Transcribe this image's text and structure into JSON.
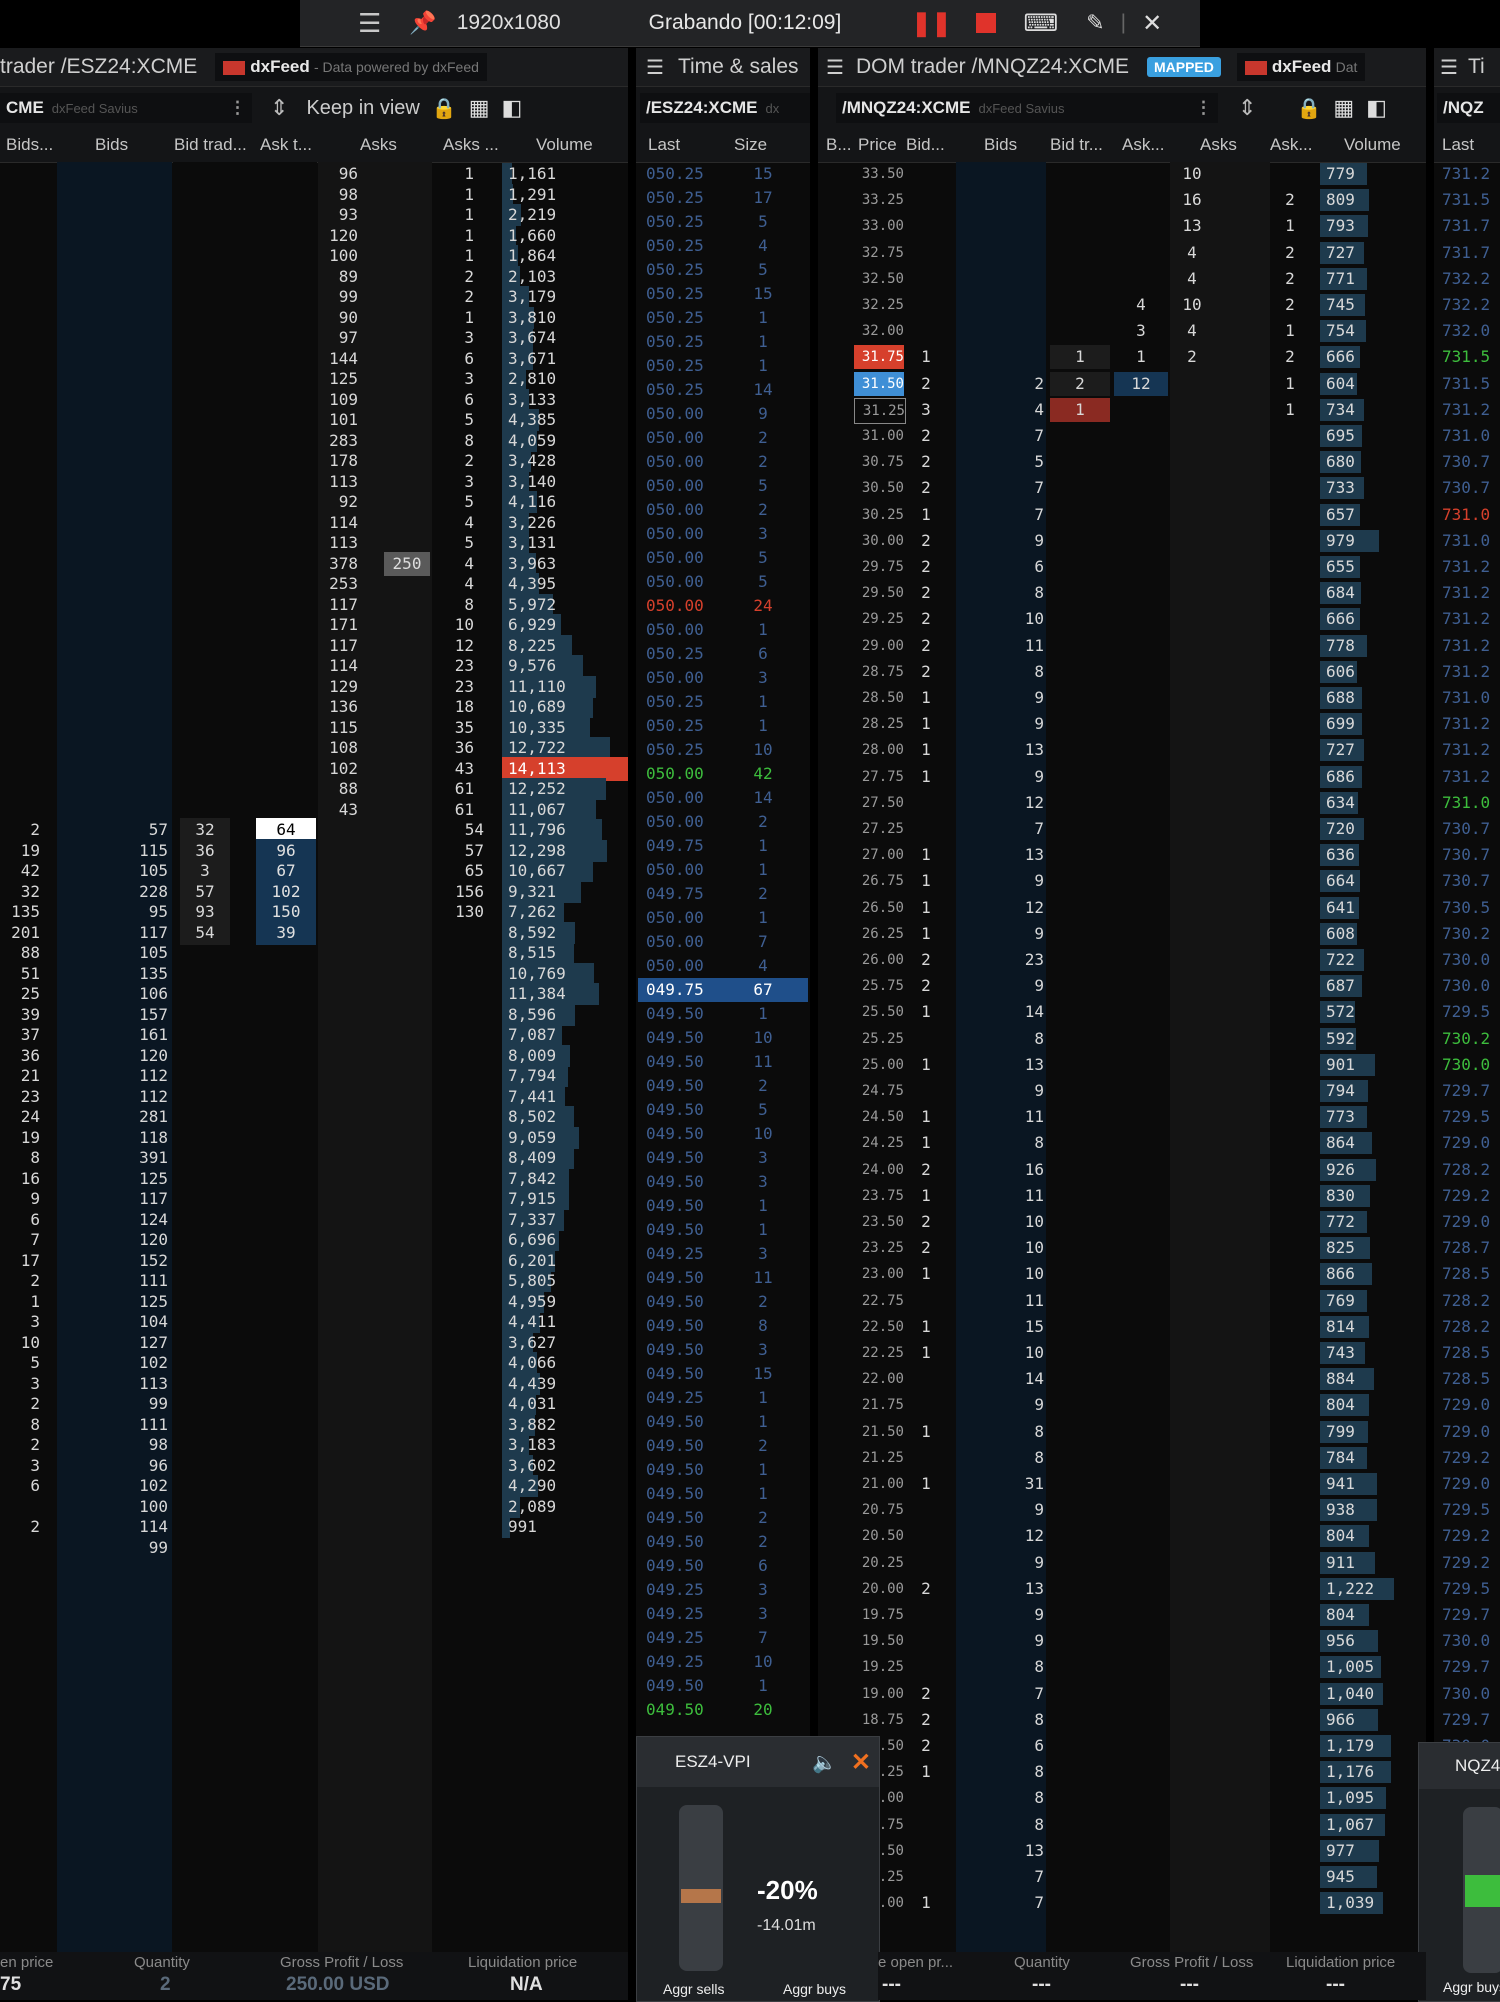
{
  "recorder": {
    "resolution": "1920x1080",
    "status": "Grabando [00:12:09]"
  },
  "es_dom": {
    "title": "trader /ESZ24:XCME",
    "feed_name": "dxFeed",
    "feed_note": "- Data powered by dxFeed",
    "symbol": "CME",
    "symbol_source": "dxFeed Savius",
    "keep_in_view": "Keep in view",
    "columns": [
      "Bids...",
      "Bids",
      "Bid trad...",
      "Ask t...",
      "Asks",
      "Asks ...",
      "Volume"
    ],
    "asks_rows": [
      [
        "96",
        "1",
        "1,161"
      ],
      [
        "98",
        "1",
        "1,291"
      ],
      [
        "93",
        "1",
        "2,219"
      ],
      [
        "120",
        "1",
        "1,660"
      ],
      [
        "100",
        "1",
        "1,864"
      ],
      [
        "89",
        "2",
        "2,103"
      ],
      [
        "99",
        "2",
        "3,179"
      ],
      [
        "90",
        "1",
        "3,810"
      ],
      [
        "97",
        "3",
        "3,674"
      ],
      [
        "144",
        "6",
        "3,671"
      ],
      [
        "125",
        "3",
        "2,810"
      ],
      [
        "109",
        "6",
        "3,133"
      ],
      [
        "101",
        "5",
        "4,385"
      ],
      [
        "283",
        "8",
        "4,059"
      ],
      [
        "178",
        "2",
        "3,428"
      ],
      [
        "113",
        "3",
        "3,140"
      ],
      [
        "92",
        "5",
        "4,116"
      ],
      [
        "114",
        "4",
        "3,226"
      ],
      [
        "113",
        "5",
        "3,131"
      ],
      [
        "378",
        "4",
        "3,963"
      ],
      [
        "253",
        "4",
        "4,395"
      ],
      [
        "117",
        "8",
        "5,972"
      ],
      [
        "171",
        "10",
        "6,929"
      ],
      [
        "117",
        "12",
        "8,225"
      ],
      [
        "114",
        "23",
        "9,576"
      ],
      [
        "129",
        "23",
        "11,110"
      ],
      [
        "136",
        "18",
        "10,689"
      ],
      [
        "115",
        "35",
        "10,335"
      ],
      [
        "108",
        "36",
        "12,722"
      ],
      [
        "102",
        "43",
        "14,113"
      ],
      [
        "88",
        "61",
        "12,252"
      ],
      [
        "43",
        "61",
        "11,067"
      ]
    ],
    "ask_pull_value": "250",
    "mid_rows": [
      [
        "2",
        "57",
        "32",
        "64",
        "54",
        "11,796"
      ],
      [
        "19",
        "115",
        "36",
        "96",
        "57",
        "12,298"
      ],
      [
        "42",
        "105",
        "3",
        "67",
        "65",
        "10,667"
      ],
      [
        "32",
        "228",
        "57",
        "102",
        "156",
        "9,321"
      ],
      [
        "135",
        "95",
        "93",
        "150",
        "130",
        "7,262"
      ],
      [
        "201",
        "117",
        "54",
        "39",
        "",
        "8,592"
      ]
    ],
    "bid_rows": [
      [
        "88",
        "105",
        "8,515"
      ],
      [
        "51",
        "135",
        "10,769"
      ],
      [
        "25",
        "106",
        "11,384"
      ],
      [
        "39",
        "157",
        "8,596"
      ],
      [
        "37",
        "161",
        "7,087"
      ],
      [
        "36",
        "120",
        "8,009"
      ],
      [
        "21",
        "112",
        "7,794"
      ],
      [
        "23",
        "112",
        "7,441"
      ],
      [
        "24",
        "281",
        "8,502"
      ],
      [
        "19",
        "118",
        "9,059"
      ],
      [
        "8",
        "391",
        "8,409"
      ],
      [
        "16",
        "125",
        "7,842"
      ],
      [
        "9",
        "117",
        "7,915"
      ],
      [
        "6",
        "124",
        "7,337"
      ],
      [
        "7",
        "120",
        "6,696"
      ],
      [
        "17",
        "152",
        "6,201"
      ],
      [
        "2",
        "111",
        "5,805"
      ],
      [
        "1",
        "125",
        "4,959"
      ],
      [
        "3",
        "104",
        "4,411"
      ],
      [
        "10",
        "127",
        "3,627"
      ],
      [
        "5",
        "102",
        "4,066"
      ],
      [
        "3",
        "113",
        "4,439"
      ],
      [
        "2",
        "99",
        "4,031"
      ],
      [
        "8",
        "111",
        "3,882"
      ],
      [
        "2",
        "98",
        "3,183"
      ],
      [
        "3",
        "96",
        "3,602"
      ],
      [
        "6",
        "102",
        "4,290"
      ],
      [
        "",
        "100",
        "2,089"
      ],
      [
        "2",
        "114",
        "991"
      ],
      [
        "",
        "99",
        ""
      ]
    ]
  },
  "es_ts": {
    "title": "Time & sales",
    "symbol": "/ESZ24:XCME",
    "symbol_source": "dx",
    "columns": [
      "Last",
      "Size"
    ],
    "rows": [
      [
        "050.25",
        "15"
      ],
      [
        "050.25",
        "17"
      ],
      [
        "050.25",
        "5"
      ],
      [
        "050.25",
        "4"
      ],
      [
        "050.25",
        "5"
      ],
      [
        "050.25",
        "15"
      ],
      [
        "050.25",
        "1"
      ],
      [
        "050.25",
        "1"
      ],
      [
        "050.25",
        "1"
      ],
      [
        "050.25",
        "14"
      ],
      [
        "050.00",
        "9"
      ],
      [
        "050.00",
        "2"
      ],
      [
        "050.00",
        "2"
      ],
      [
        "050.00",
        "5"
      ],
      [
        "050.00",
        "2"
      ],
      [
        "050.00",
        "3"
      ],
      [
        "050.00",
        "5"
      ],
      [
        "050.00",
        "5"
      ],
      [
        "050.00",
        "24"
      ],
      [
        "050.00",
        "1"
      ],
      [
        "050.25",
        "6"
      ],
      [
        "050.00",
        "3"
      ],
      [
        "050.25",
        "1"
      ],
      [
        "050.25",
        "1"
      ],
      [
        "050.25",
        "10"
      ],
      [
        "050.00",
        "42"
      ],
      [
        "050.00",
        "14"
      ],
      [
        "050.00",
        "2"
      ],
      [
        "049.75",
        "1"
      ],
      [
        "050.00",
        "1"
      ],
      [
        "049.75",
        "2"
      ],
      [
        "050.00",
        "1"
      ],
      [
        "050.00",
        "7"
      ],
      [
        "050.00",
        "4"
      ],
      [
        "049.75",
        "67"
      ],
      [
        "049.50",
        "1"
      ],
      [
        "049.50",
        "10"
      ],
      [
        "049.50",
        "11"
      ],
      [
        "049.50",
        "2"
      ],
      [
        "049.50",
        "5"
      ],
      [
        "049.50",
        "10"
      ],
      [
        "049.50",
        "3"
      ],
      [
        "049.50",
        "3"
      ],
      [
        "049.50",
        "1"
      ],
      [
        "049.50",
        "1"
      ],
      [
        "049.25",
        "3"
      ],
      [
        "049.50",
        "11"
      ],
      [
        "049.50",
        "2"
      ],
      [
        "049.50",
        "8"
      ],
      [
        "049.50",
        "3"
      ],
      [
        "049.50",
        "15"
      ],
      [
        "049.25",
        "1"
      ],
      [
        "049.50",
        "1"
      ],
      [
        "049.50",
        "2"
      ],
      [
        "049.50",
        "1"
      ],
      [
        "049.50",
        "1"
      ],
      [
        "049.50",
        "2"
      ],
      [
        "049.50",
        "2"
      ],
      [
        "049.50",
        "6"
      ],
      [
        "049.25",
        "3"
      ],
      [
        "049.25",
        "3"
      ],
      [
        "049.25",
        "7"
      ],
      [
        "049.25",
        "10"
      ],
      [
        "049.50",
        "1"
      ],
      [
        "049.50",
        "20"
      ]
    ]
  },
  "nq_dom": {
    "title": "DOM trader /MNQZ24:XCME",
    "badge": "MAPPED",
    "feed_name": "dxFeed",
    "feed_note": "Dat",
    "symbol": "/MNQZ24:XCME",
    "symbol_source": "dxFeed Savius",
    "columns": [
      "B...",
      "Price",
      "Bid...",
      "Bids",
      "Bid tr...",
      "Ask...",
      "Asks",
      "Ask...",
      "Volume"
    ],
    "rows": [
      [
        "",
        "33.50",
        "",
        "",
        "",
        "",
        "10",
        "",
        "779"
      ],
      [
        "",
        "33.25",
        "",
        "",
        "",
        "",
        "16",
        "2",
        "809"
      ],
      [
        "",
        "33.00",
        "",
        "",
        "",
        "",
        "13",
        "1",
        "793"
      ],
      [
        "",
        "32.75",
        "",
        "",
        "",
        "",
        "4",
        "2",
        "727"
      ],
      [
        "",
        "32.50",
        "",
        "",
        "",
        "",
        "4",
        "2",
        "771"
      ],
      [
        "",
        "32.25",
        "",
        "",
        "",
        "4",
        "10",
        "2",
        "745"
      ],
      [
        "",
        "32.00",
        "",
        "",
        "",
        "3",
        "4",
        "1",
        "754"
      ],
      [
        "",
        "31.75",
        "1",
        "",
        "1",
        "1",
        "2",
        "2",
        "666"
      ],
      [
        "",
        "31.50",
        "2",
        "2",
        "2",
        "12",
        "",
        "1",
        "604"
      ],
      [
        "",
        "31.25",
        "3",
        "4",
        "1",
        "",
        "",
        "1",
        "734"
      ],
      [
        "",
        "31.00",
        "2",
        "7",
        "",
        "",
        "",
        "",
        "695"
      ],
      [
        "",
        "30.75",
        "2",
        "5",
        "",
        "",
        "",
        "",
        "680"
      ],
      [
        "",
        "30.50",
        "2",
        "7",
        "",
        "",
        "",
        "",
        "733"
      ],
      [
        "",
        "30.25",
        "1",
        "7",
        "",
        "",
        "",
        "",
        "657"
      ],
      [
        "",
        "30.00",
        "2",
        "9",
        "",
        "",
        "",
        "",
        "979"
      ],
      [
        "",
        "29.75",
        "2",
        "6",
        "",
        "",
        "",
        "",
        "655"
      ],
      [
        "",
        "29.50",
        "2",
        "8",
        "",
        "",
        "",
        "",
        "684"
      ],
      [
        "",
        "29.25",
        "2",
        "10",
        "",
        "",
        "",
        "",
        "666"
      ],
      [
        "",
        "29.00",
        "2",
        "11",
        "",
        "",
        "",
        "",
        "778"
      ],
      [
        "",
        "28.75",
        "2",
        "8",
        "",
        "",
        "",
        "",
        "606"
      ],
      [
        "",
        "28.50",
        "1",
        "9",
        "",
        "",
        "",
        "",
        "688"
      ],
      [
        "",
        "28.25",
        "1",
        "9",
        "",
        "",
        "",
        "",
        "699"
      ],
      [
        "",
        "28.00",
        "1",
        "13",
        "",
        "",
        "",
        "",
        "727"
      ],
      [
        "",
        "27.75",
        "1",
        "9",
        "",
        "",
        "",
        "",
        "686"
      ],
      [
        "",
        "27.50",
        "",
        "12",
        "",
        "",
        "",
        "",
        "634"
      ],
      [
        "",
        "27.25",
        "",
        "7",
        "",
        "",
        "",
        "",
        "720"
      ],
      [
        "",
        "27.00",
        "1",
        "13",
        "",
        "",
        "",
        "",
        "636"
      ],
      [
        "",
        "26.75",
        "1",
        "9",
        "",
        "",
        "",
        "",
        "664"
      ],
      [
        "",
        "26.50",
        "1",
        "12",
        "",
        "",
        "",
        "",
        "641"
      ],
      [
        "",
        "26.25",
        "1",
        "9",
        "",
        "",
        "",
        "",
        "608"
      ],
      [
        "",
        "26.00",
        "2",
        "23",
        "",
        "",
        "",
        "",
        "722"
      ],
      [
        "",
        "25.75",
        "2",
        "9",
        "",
        "",
        "",
        "",
        "687"
      ],
      [
        "",
        "25.50",
        "1",
        "14",
        "",
        "",
        "",
        "",
        "572"
      ],
      [
        "",
        "25.25",
        "",
        "8",
        "",
        "",
        "",
        "",
        "592"
      ],
      [
        "",
        "25.00",
        "1",
        "13",
        "",
        "",
        "",
        "",
        "901"
      ],
      [
        "",
        "24.75",
        "",
        "9",
        "",
        "",
        "",
        "",
        "794"
      ],
      [
        "",
        "24.50",
        "1",
        "11",
        "",
        "",
        "",
        "",
        "773"
      ],
      [
        "",
        "24.25",
        "1",
        "8",
        "",
        "",
        "",
        "",
        "864"
      ],
      [
        "",
        "24.00",
        "2",
        "16",
        "",
        "",
        "",
        "",
        "926"
      ],
      [
        "",
        "23.75",
        "1",
        "11",
        "",
        "",
        "",
        "",
        "830"
      ],
      [
        "",
        "23.50",
        "2",
        "10",
        "",
        "",
        "",
        "",
        "772"
      ],
      [
        "",
        "23.25",
        "2",
        "10",
        "",
        "",
        "",
        "",
        "825"
      ],
      [
        "",
        "23.00",
        "1",
        "10",
        "",
        "",
        "",
        "",
        "866"
      ],
      [
        "",
        "22.75",
        "",
        "11",
        "",
        "",
        "",
        "",
        "769"
      ],
      [
        "",
        "22.50",
        "1",
        "15",
        "",
        "",
        "",
        "",
        "814"
      ],
      [
        "",
        "22.25",
        "1",
        "10",
        "",
        "",
        "",
        "",
        "743"
      ],
      [
        "",
        "22.00",
        "",
        "14",
        "",
        "",
        "",
        "",
        "884"
      ],
      [
        "",
        "21.75",
        "",
        "9",
        "",
        "",
        "",
        "",
        "804"
      ],
      [
        "",
        "21.50",
        "1",
        "8",
        "",
        "",
        "",
        "",
        "799"
      ],
      [
        "",
        "21.25",
        "",
        "8",
        "",
        "",
        "",
        "",
        "784"
      ],
      [
        "",
        "21.00",
        "1",
        "31",
        "",
        "",
        "",
        "",
        "941"
      ],
      [
        "",
        "20.75",
        "",
        "9",
        "",
        "",
        "",
        "",
        "938"
      ],
      [
        "",
        "20.50",
        "",
        "12",
        "",
        "",
        "",
        "",
        "804"
      ],
      [
        "",
        "20.25",
        "",
        "9",
        "",
        "",
        "",
        "",
        "911"
      ],
      [
        "",
        "20.00",
        "2",
        "13",
        "",
        "",
        "",
        "",
        "1,222"
      ],
      [
        "",
        "19.75",
        "",
        "9",
        "",
        "",
        "",
        "",
        "804"
      ],
      [
        "",
        "19.50",
        "",
        "9",
        "",
        "",
        "",
        "",
        "956"
      ],
      [
        "",
        "19.25",
        "",
        "8",
        "",
        "",
        "",
        "",
        "1,005"
      ],
      [
        "",
        "19.00",
        "2",
        "7",
        "",
        "",
        "",
        "",
        "1,040"
      ],
      [
        "",
        "18.75",
        "2",
        "8",
        "",
        "",
        "",
        "",
        "966"
      ],
      [
        "",
        "18.50",
        "2",
        "6",
        "",
        "",
        "",
        "",
        "1,179"
      ],
      [
        "",
        "18.25",
        "1",
        "8",
        "",
        "",
        "",
        "",
        "1,176"
      ],
      [
        "",
        "18.00",
        "",
        "8",
        "",
        "",
        "",
        "",
        "1,095"
      ],
      [
        "",
        "17.75",
        "",
        "8",
        "",
        "",
        "",
        "",
        "1,067"
      ],
      [
        "",
        "17.50",
        "",
        "13",
        "",
        "",
        "",
        "",
        "977"
      ],
      [
        "",
        "17.25",
        "",
        "7",
        "",
        "",
        "",
        "",
        "945"
      ],
      [
        "",
        "17.00",
        "1",
        "7",
        "",
        "",
        "",
        "",
        "1,039"
      ]
    ]
  },
  "nq_ts": {
    "title": "Ti",
    "symbol": "/NQZ",
    "columns": [
      "Last"
    ],
    "rows": [
      "731.2",
      "731.5",
      "731.7",
      "731.7",
      "732.2",
      "732.2",
      "732.0",
      "731.5",
      "731.5",
      "731.2",
      "731.0",
      "730.7",
      "730.7",
      "731.0",
      "731.0",
      "731.2",
      "731.2",
      "731.2",
      "731.2",
      "731.2",
      "731.0",
      "731.2",
      "731.2",
      "731.2",
      "731.0",
      "730.7",
      "730.7",
      "730.7",
      "730.5",
      "730.2",
      "730.0",
      "730.0",
      "729.5",
      "730.2",
      "730.0",
      "729.7",
      "729.5",
      "729.0",
      "728.2",
      "729.2",
      "729.0",
      "728.7",
      "728.5",
      "728.2",
      "728.2",
      "728.5",
      "728.5",
      "729.0",
      "729.0",
      "729.2",
      "729.0",
      "729.5",
      "729.2",
      "729.2",
      "729.5",
      "729.7",
      "730.0",
      "729.7",
      "730.0",
      "729.7",
      "730.0",
      "730.0",
      "729.5"
    ]
  },
  "es_vpi": {
    "title": "ESZ4-VPI",
    "percent": "-20%",
    "amount": "-14.01m",
    "sell_label": "Aggr sells",
    "buy_label": "Aggr buys",
    "level": 0.5
  },
  "nq_vpi": {
    "title": "NQZ4",
    "buy_label": "Aggr buys"
  },
  "es_bottom": {
    "labels": [
      "en price",
      "Quantity",
      "Gross Profit / Loss",
      "Liquidation price"
    ],
    "values": [
      "75",
      "2",
      "250.00 USD",
      "N/A"
    ]
  },
  "nq_bottom": {
    "labels": [
      "e open pr...",
      "Quantity",
      "Gross Profit / Loss",
      "Liquidation price"
    ],
    "values": [
      "---",
      "---",
      "---",
      "---"
    ]
  },
  "colors": {
    "buy": "#3f8fd6",
    "sell": "#d6402c",
    "green": "#3dbd3d",
    "volume_bar": "#1e3a4d",
    "bid_band": "#0d1a2a"
  }
}
